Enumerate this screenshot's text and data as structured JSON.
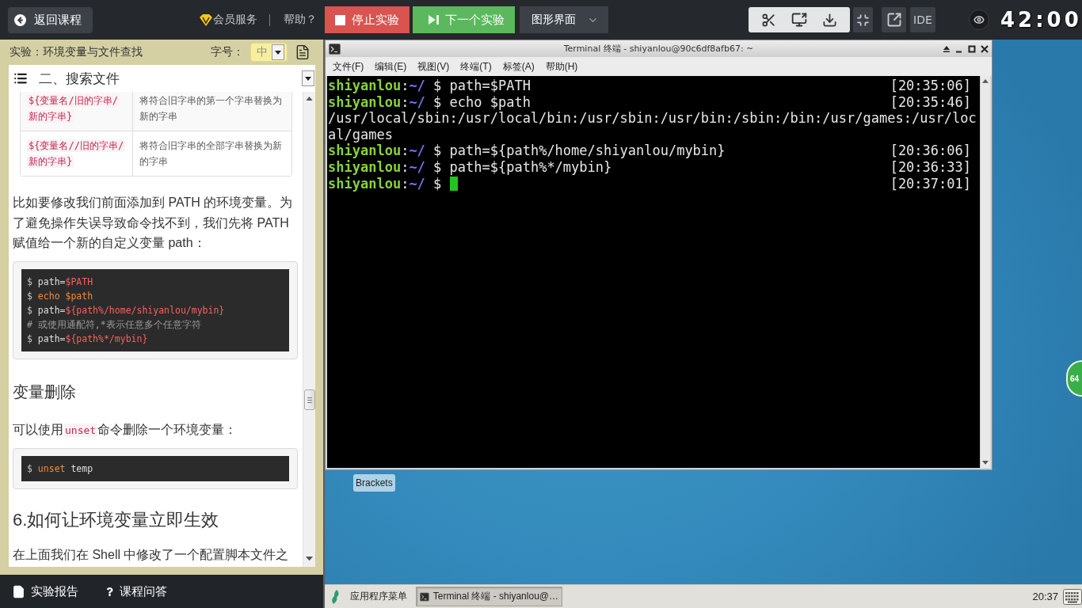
{
  "top_bar": {
    "back_button": "返回课程",
    "vip_link": "会员服务",
    "help_link": "帮助？",
    "stop_button": "停止实验",
    "next_button": "下一个实验",
    "view_select": "图形界面",
    "ide_button": "IDE",
    "timer": "42:00"
  },
  "lab_panel": {
    "title": "实验：环境变量与文件查找",
    "font_size_label": "字号：",
    "font_size_value": "中",
    "chapter_select": "二、搜索文件",
    "content": [
      {
        "kind": "table",
        "rows": [
          {
            "code": "${变量名/旧的字串/新的字串}",
            "description": "将符合旧字串的第一个字串替换为新的字串"
          },
          {
            "code": "${变量名//旧的字串/新的字串}",
            "description": "将符合旧字串的全部字串替换为新的字串"
          }
        ]
      },
      {
        "kind": "paragraph",
        "parts": [
          {
            "kind": "text",
            "text": "比如要修改我们前面添加到 PATH 的环境变量。为了避免操作失误导致命令找不到，我们先将 PATH 赋值给一个新的自定义变量 path："
          }
        ]
      },
      {
        "kind": "code",
        "lines": [
          [
            {
              "kind": "prompt",
              "text": "$ "
            },
            {
              "kind": "plain",
              "text": "path="
            },
            {
              "kind": "variable",
              "text": "$PATH"
            }
          ],
          [
            {
              "kind": "prompt",
              "text": "$ "
            },
            {
              "kind": "builtin",
              "text": "echo $path"
            }
          ],
          [
            {
              "kind": "prompt",
              "text": "$ "
            },
            {
              "kind": "plain",
              "text": "path="
            },
            {
              "kind": "variable",
              "text": "${path%/home/shiyanlou/mybin}"
            }
          ],
          [
            {
              "kind": "comment",
              "text": "# 或使用通配符,*表示任意多个任意字符"
            }
          ],
          [
            {
              "kind": "prompt",
              "text": "$ "
            },
            {
              "kind": "plain",
              "text": "path="
            },
            {
              "kind": "variable",
              "text": "${path%*/mybin}"
            }
          ]
        ]
      },
      {
        "kind": "subheading",
        "text": "变量删除"
      },
      {
        "kind": "paragraph",
        "parts": [
          {
            "kind": "text",
            "text": "可以使用"
          },
          {
            "kind": "code",
            "text": "unset"
          },
          {
            "kind": "text",
            "text": "命令删除一个环境变量："
          }
        ]
      },
      {
        "kind": "code",
        "lines": [
          [
            {
              "kind": "prompt",
              "text": "$ "
            },
            {
              "kind": "builtin",
              "text": "unset"
            },
            {
              "kind": "plain",
              "text": " temp"
            }
          ]
        ]
      },
      {
        "kind": "heading",
        "text": "6.如何让环境变量立即生效"
      },
      {
        "kind": "paragraph",
        "parts": [
          {
            "kind": "text",
            "text": "在上面我们在 Shell 中修改了一个配置脚本文件之"
          }
        ]
      }
    ]
  },
  "footer_links": [
    {
      "kind": "report",
      "label": "实验报告"
    },
    {
      "kind": "qa",
      "label": "课程问答"
    }
  ],
  "terminal": {
    "title": "Terminal 终端 - shiyanlou@90c6df8afb67: ~",
    "menu": [
      "文件(F)",
      "编辑(E)",
      "视图(V)",
      "终端(T)",
      "标签(A)",
      "帮助(H)"
    ],
    "lines": [
      {
        "parts": [
          {
            "kind": "user",
            "text": "shiyanlou"
          },
          {
            "kind": "plain",
            "text": ":"
          },
          {
            "kind": "path",
            "text": "~/"
          },
          {
            "kind": "plain",
            "text": " $ path=$PATH"
          }
        ],
        "time": "[20:35:06]",
        "cursor": false
      },
      {
        "parts": [
          {
            "kind": "user",
            "text": "shiyanlou"
          },
          {
            "kind": "plain",
            "text": ":"
          },
          {
            "kind": "path",
            "text": "~/"
          },
          {
            "kind": "plain",
            "text": " $ echo $path"
          }
        ],
        "time": "[20:35:46]",
        "cursor": false
      },
      {
        "parts": [
          {
            "kind": "plain",
            "text": "/usr/local/sbin:/usr/local/bin:/usr/sbin:/usr/bin:/sbin:/bin:/usr/games:/usr/loc"
          }
        ],
        "cursor": false
      },
      {
        "parts": [
          {
            "kind": "plain",
            "text": "al/games"
          }
        ],
        "cursor": false
      },
      {
        "parts": [
          {
            "kind": "user",
            "text": "shiyanlou"
          },
          {
            "kind": "plain",
            "text": ":"
          },
          {
            "kind": "path",
            "text": "~/"
          },
          {
            "kind": "plain",
            "text": " $ path=${path%/home/shiyanlou/mybin}"
          }
        ],
        "time": "[20:36:06]",
        "cursor": false
      },
      {
        "parts": [
          {
            "kind": "user",
            "text": "shiyanlou"
          },
          {
            "kind": "plain",
            "text": ":"
          },
          {
            "kind": "path",
            "text": "~/"
          },
          {
            "kind": "plain",
            "text": " $ path=${path%*/mybin}"
          }
        ],
        "time": "[20:36:33]",
        "cursor": false
      },
      {
        "parts": [
          {
            "kind": "user",
            "text": "shiyanlou"
          },
          {
            "kind": "plain",
            "text": ":"
          },
          {
            "kind": "path",
            "text": "~/"
          },
          {
            "kind": "plain",
            "text": " $ "
          }
        ],
        "time": "[20:37:01]",
        "cursor": true
      }
    ]
  },
  "desktop_icons": [
    {
      "label": "Brackets"
    }
  ],
  "taskbar": {
    "start_menu": "应用程序菜单",
    "tasks": [
      {
        "label": "Terminal 终端 - shiyanlou@…",
        "selected": true
      }
    ],
    "clock": "20:37"
  },
  "badge": "64"
}
